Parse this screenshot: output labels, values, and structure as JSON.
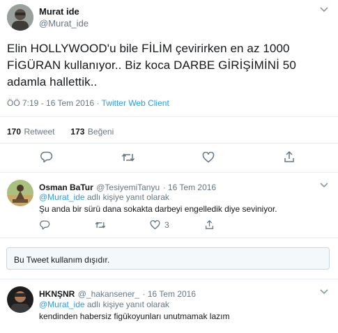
{
  "main_tweet": {
    "author_name": "Murat ide",
    "author_handle": "@Murat_ide",
    "text": "Elin HOLLYWOOD'u bile FİLİM çevirirken en az 1000 FİGÜRAN kullanıyor.. Biz koca DARBE GİRİŞİMİNİ 50 adamla hallettik..",
    "time": "ÖÖ 7:19 - 16 Tem 2016",
    "separator": " · ",
    "client": "Twitter Web Client",
    "retweet_count": "170",
    "retweet_label": "Retweet",
    "like_count": "173",
    "like_label": "Beğeni"
  },
  "replies": [
    {
      "author_name": "Osman BaTur",
      "author_handle": "@TesiyemiTanyu",
      "date": "· 16 Tem 2016",
      "reply_to_handle": "@Murat_ide",
      "reply_to_suffix": " adlı kişiye yanıt olarak",
      "text": "Şu anda bir sürü dana sokakta darbeyi engelledik diye seviniyor.",
      "like_count": "3"
    },
    {
      "author_name": "HKNŞNR",
      "author_handle": "@_hakansener_",
      "date": "· 16 Tem 2016",
      "reply_to_handle": "@Murat_ide",
      "reply_to_suffix": " adlı kişiye yanıt olarak",
      "text": "kendinden habersiz figükoyunları unutmamak lazım"
    }
  ],
  "unavailable_tweet": "Bu Tweet kullanım dışıdır.",
  "icons": {
    "reply": "reply-icon",
    "retweet": "retweet-icon",
    "like": "heart-icon",
    "share": "share-icon",
    "menu": "chevron-down-icon"
  },
  "colors": {
    "link": "#1da1f2",
    "secondary_text": "#657786",
    "divider": "#e6ecf0"
  }
}
